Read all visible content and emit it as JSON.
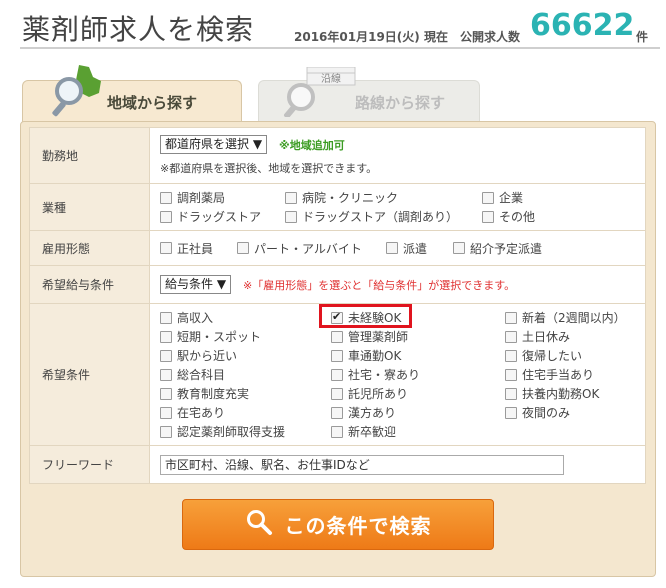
{
  "header": {
    "title": "薬剤師求人を検索",
    "date": "2016年01月19日(火) 現在",
    "count_label": "公開求人数",
    "count": "66622",
    "count_unit": "件"
  },
  "tabs": {
    "region": "地域から探す",
    "route": "路線から探す",
    "route_sign": "沿線"
  },
  "form": {
    "workplace": {
      "label": "勤務地",
      "select": "都道府県を選択 ▼",
      "add_region": "※地域追加可",
      "note": "※都道府県を選択後、地域を選択できます。"
    },
    "industry": {
      "label": "業種",
      "options": [
        "調剤薬局",
        "病院・クリニック",
        "企業",
        "ドラッグストア",
        "ドラッグストア（調剤あり）",
        "その他"
      ]
    },
    "employment": {
      "label": "雇用形態",
      "options": [
        "正社員",
        "パート・アルバイト",
        "派遣",
        "紹介予定派遣"
      ]
    },
    "salary": {
      "label": "希望給与条件",
      "select": "給与条件 ▼",
      "note": "※「雇用形態」を選ぶと「給与条件」が選択できます。"
    },
    "conditions": {
      "label": "希望条件",
      "col1": [
        "高収入",
        "短期・スポット",
        "駅から近い",
        "総合科目",
        "教育制度充実",
        "在宅あり",
        "認定薬剤師取得支援"
      ],
      "col2": [
        "未経験OK",
        "管理薬剤師",
        "車通勤OK",
        "社宅・寮あり",
        "託児所あり",
        "漢方あり",
        "新卒歓迎"
      ],
      "col3": [
        "新着（2週間以内）",
        "土日休み",
        "復帰したい",
        "住宅手当あり",
        "扶養内勤務OK",
        "夜間のみ"
      ]
    },
    "freeword": {
      "label": "フリーワード",
      "value": "市区町村、沿線、駅名、お仕事IDなど"
    }
  },
  "search_button": "この条件で検索"
}
